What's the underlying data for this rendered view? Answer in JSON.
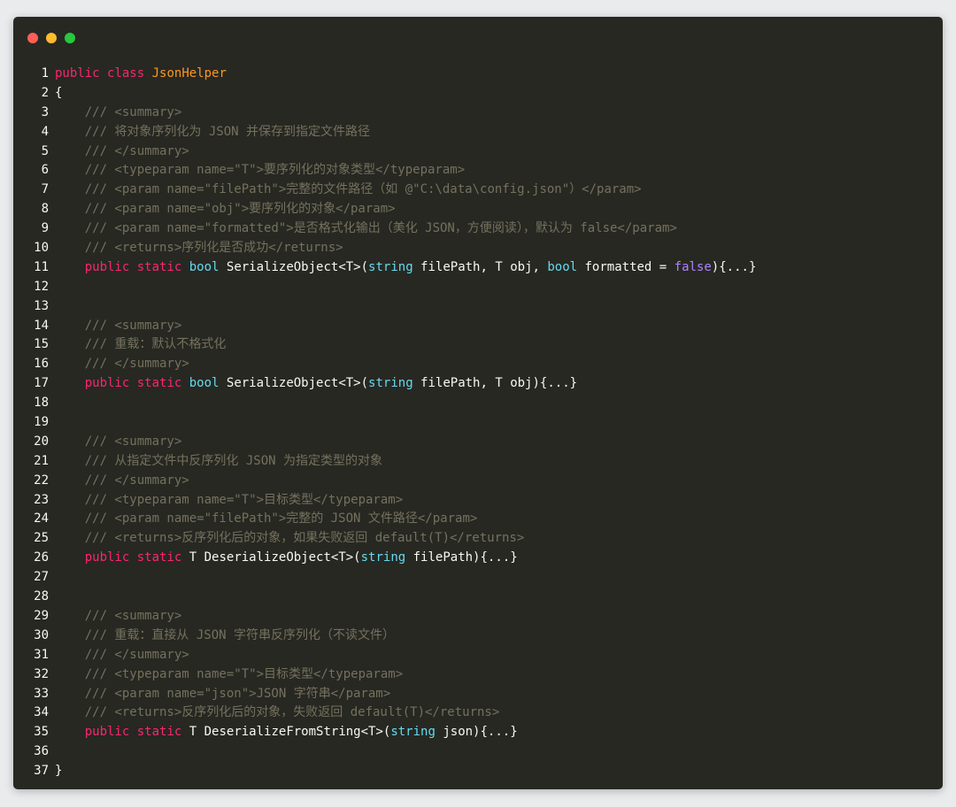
{
  "colors": {
    "window_bg": "#272822",
    "page_bg": "#e9ebed",
    "keyword": "#f92672",
    "type": "#66d9ef",
    "classname": "#fd971f",
    "comment": "#75715e",
    "literal": "#ae81ff",
    "plain": "#f8f8f2"
  },
  "window_controls": [
    {
      "name": "close",
      "color": "#ff5f56"
    },
    {
      "name": "minimize",
      "color": "#ffbd2e"
    },
    {
      "name": "maximize",
      "color": "#27c93f"
    }
  ],
  "lines": [
    {
      "num": "1",
      "tokens": [
        [
          "keyword",
          "public"
        ],
        [
          "plain",
          " "
        ],
        [
          "keyword",
          "class"
        ],
        [
          "plain",
          " "
        ],
        [
          "classname",
          "JsonHelper"
        ]
      ]
    },
    {
      "num": "2",
      "tokens": [
        [
          "plain",
          "{"
        ]
      ]
    },
    {
      "num": "3",
      "tokens": [
        [
          "plain",
          "    "
        ],
        [
          "comment",
          "/// <summary>"
        ]
      ]
    },
    {
      "num": "4",
      "tokens": [
        [
          "plain",
          "    "
        ],
        [
          "comment",
          "/// 将对象序列化为 JSON 并保存到指定文件路径"
        ]
      ]
    },
    {
      "num": "5",
      "tokens": [
        [
          "plain",
          "    "
        ],
        [
          "comment",
          "/// </summary>"
        ]
      ]
    },
    {
      "num": "6",
      "tokens": [
        [
          "plain",
          "    "
        ],
        [
          "comment",
          "/// <typeparam name=\"T\">要序列化的对象类型</typeparam>"
        ]
      ]
    },
    {
      "num": "7",
      "tokens": [
        [
          "plain",
          "    "
        ],
        [
          "comment",
          "/// <param name=\"filePath\">完整的文件路径（如 @\"C:\\data\\config.json\"）</param>"
        ]
      ]
    },
    {
      "num": "8",
      "tokens": [
        [
          "plain",
          "    "
        ],
        [
          "comment",
          "/// <param name=\"obj\">要序列化的对象</param>"
        ]
      ]
    },
    {
      "num": "9",
      "tokens": [
        [
          "plain",
          "    "
        ],
        [
          "comment",
          "/// <param name=\"formatted\">是否格式化输出（美化 JSON，方便阅读），默认为 false</param>"
        ]
      ]
    },
    {
      "num": "10",
      "tokens": [
        [
          "plain",
          "    "
        ],
        [
          "comment",
          "/// <returns>序列化是否成功</returns>"
        ]
      ]
    },
    {
      "num": "11",
      "tokens": [
        [
          "plain",
          "    "
        ],
        [
          "keyword",
          "public"
        ],
        [
          "plain",
          " "
        ],
        [
          "keyword",
          "static"
        ],
        [
          "plain",
          " "
        ],
        [
          "type",
          "bool"
        ],
        [
          "plain",
          " SerializeObject<T>("
        ],
        [
          "type",
          "string"
        ],
        [
          "plain",
          " filePath, T obj, "
        ],
        [
          "type",
          "bool"
        ],
        [
          "plain",
          " formatted = "
        ],
        [
          "literal",
          "false"
        ],
        [
          "plain",
          "){...}"
        ]
      ]
    },
    {
      "num": "12",
      "tokens": []
    },
    {
      "num": "13",
      "tokens": []
    },
    {
      "num": "14",
      "tokens": [
        [
          "plain",
          "    "
        ],
        [
          "comment",
          "/// <summary>"
        ]
      ]
    },
    {
      "num": "15",
      "tokens": [
        [
          "plain",
          "    "
        ],
        [
          "comment",
          "/// 重载：默认不格式化"
        ]
      ]
    },
    {
      "num": "16",
      "tokens": [
        [
          "plain",
          "    "
        ],
        [
          "comment",
          "/// </summary>"
        ]
      ]
    },
    {
      "num": "17",
      "tokens": [
        [
          "plain",
          "    "
        ],
        [
          "keyword",
          "public"
        ],
        [
          "plain",
          " "
        ],
        [
          "keyword",
          "static"
        ],
        [
          "plain",
          " "
        ],
        [
          "type",
          "bool"
        ],
        [
          "plain",
          " SerializeObject<T>("
        ],
        [
          "type",
          "string"
        ],
        [
          "plain",
          " filePath, T obj){...}"
        ]
      ]
    },
    {
      "num": "18",
      "tokens": []
    },
    {
      "num": "19",
      "tokens": []
    },
    {
      "num": "20",
      "tokens": [
        [
          "plain",
          "    "
        ],
        [
          "comment",
          "/// <summary>"
        ]
      ]
    },
    {
      "num": "21",
      "tokens": [
        [
          "plain",
          "    "
        ],
        [
          "comment",
          "/// 从指定文件中反序列化 JSON 为指定类型的对象"
        ]
      ]
    },
    {
      "num": "22",
      "tokens": [
        [
          "plain",
          "    "
        ],
        [
          "comment",
          "/// </summary>"
        ]
      ]
    },
    {
      "num": "23",
      "tokens": [
        [
          "plain",
          "    "
        ],
        [
          "comment",
          "/// <typeparam name=\"T\">目标类型</typeparam>"
        ]
      ]
    },
    {
      "num": "24",
      "tokens": [
        [
          "plain",
          "    "
        ],
        [
          "comment",
          "/// <param name=\"filePath\">完整的 JSON 文件路径</param>"
        ]
      ]
    },
    {
      "num": "25",
      "tokens": [
        [
          "plain",
          "    "
        ],
        [
          "comment",
          "/// <returns>反序列化后的对象，如果失败返回 default(T)</returns>"
        ]
      ]
    },
    {
      "num": "26",
      "tokens": [
        [
          "plain",
          "    "
        ],
        [
          "keyword",
          "public"
        ],
        [
          "plain",
          " "
        ],
        [
          "keyword",
          "static"
        ],
        [
          "plain",
          " T DeserializeObject<T>("
        ],
        [
          "type",
          "string"
        ],
        [
          "plain",
          " filePath){...}"
        ]
      ]
    },
    {
      "num": "27",
      "tokens": []
    },
    {
      "num": "28",
      "tokens": []
    },
    {
      "num": "29",
      "tokens": [
        [
          "plain",
          "    "
        ],
        [
          "comment",
          "/// <summary>"
        ]
      ]
    },
    {
      "num": "30",
      "tokens": [
        [
          "plain",
          "    "
        ],
        [
          "comment",
          "/// 重载：直接从 JSON 字符串反序列化（不读文件）"
        ]
      ]
    },
    {
      "num": "31",
      "tokens": [
        [
          "plain",
          "    "
        ],
        [
          "comment",
          "/// </summary>"
        ]
      ]
    },
    {
      "num": "32",
      "tokens": [
        [
          "plain",
          "    "
        ],
        [
          "comment",
          "/// <typeparam name=\"T\">目标类型</typeparam>"
        ]
      ]
    },
    {
      "num": "33",
      "tokens": [
        [
          "plain",
          "    "
        ],
        [
          "comment",
          "/// <param name=\"json\">JSON 字符串</param>"
        ]
      ]
    },
    {
      "num": "34",
      "tokens": [
        [
          "plain",
          "    "
        ],
        [
          "comment",
          "/// <returns>反序列化后的对象，失败返回 default(T)</returns>"
        ]
      ]
    },
    {
      "num": "35",
      "tokens": [
        [
          "plain",
          "    "
        ],
        [
          "keyword",
          "public"
        ],
        [
          "plain",
          " "
        ],
        [
          "keyword",
          "static"
        ],
        [
          "plain",
          " T DeserializeFromString<T>("
        ],
        [
          "type",
          "string"
        ],
        [
          "plain",
          " json){...}"
        ]
      ]
    },
    {
      "num": "36",
      "tokens": []
    },
    {
      "num": "37",
      "tokens": [
        [
          "plain",
          "}"
        ]
      ]
    }
  ]
}
